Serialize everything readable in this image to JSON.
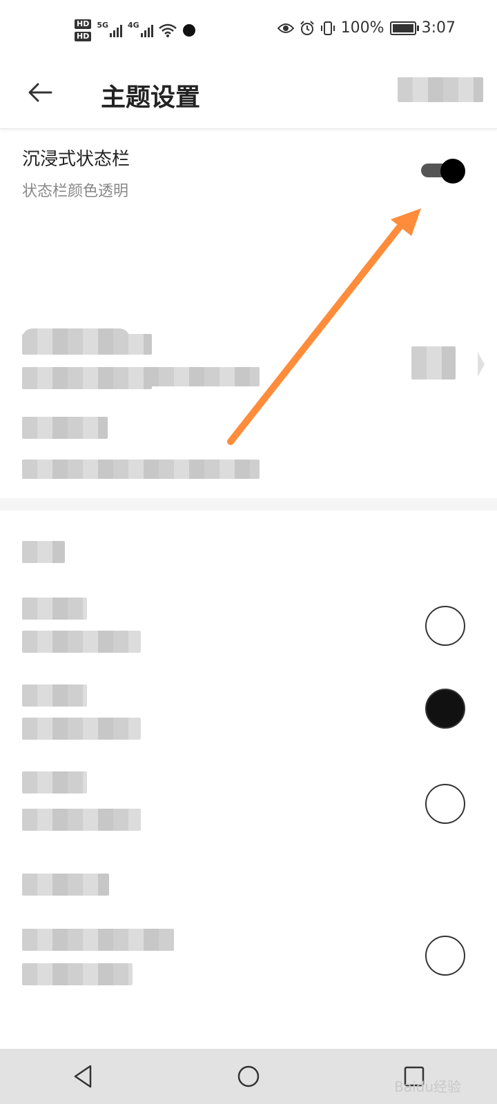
{
  "status_bar": {
    "hd1": "HD",
    "hd2": "HD",
    "net1": "5G",
    "net2": "4G",
    "battery": "100%",
    "time": "3:07",
    "battery_level": 1.0
  },
  "header": {
    "title": "主题设置"
  },
  "immersive_status_bar": {
    "title": "沉浸式状态栏",
    "subtitle": "状态栏颜色透明",
    "enabled": true
  },
  "colors": {
    "accent_arrow": "#FF8C3A",
    "text_primary": "#222222",
    "text_secondary": "#888888"
  },
  "watermark": "Baidu经验"
}
